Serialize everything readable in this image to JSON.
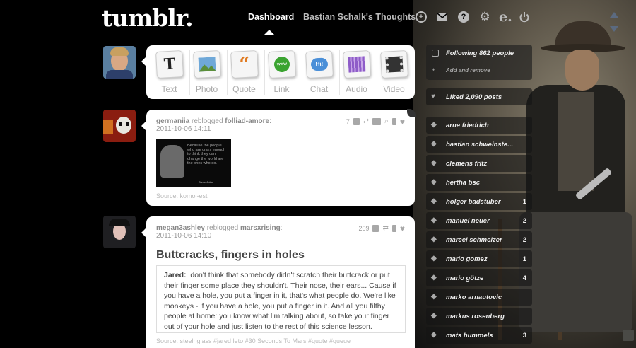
{
  "header": {
    "logo": "tumblr.",
    "nav_dashboard": "Dashboard",
    "nav_blog": "Bastian Schalk's Thoughts",
    "icons": [
      "plus-circle-icon",
      "mail-icon",
      "help-icon",
      "gear-icon",
      "etsy-e-icon",
      "power-icon"
    ]
  },
  "compose": {
    "items": [
      {
        "label": "Text",
        "icon": "T"
      },
      {
        "label": "Photo",
        "icon": "photo"
      },
      {
        "label": "Quote",
        "icon": "quote"
      },
      {
        "label": "Link",
        "icon": "www"
      },
      {
        "label": "Chat",
        "icon": "Hi!"
      },
      {
        "label": "Audio",
        "icon": "audio"
      },
      {
        "label": "Video",
        "icon": "video"
      }
    ]
  },
  "posts": [
    {
      "user": "germaniia",
      "verb": "reblogged",
      "source_user": "folliad-amore",
      "date": "2011-10-06 14:11",
      "notes": "7",
      "image_caption": "Because the people who are crazy enough to think they can change the world are the ones who do.",
      "image_author": "Steve Jobs",
      "source": "Source: komol-esti"
    },
    {
      "user": "megan3ashley",
      "verb": "reblogged",
      "source_user": "marsxrising",
      "date": "2011-10-06 14:10",
      "notes": "209",
      "title": "Buttcracks, fingers in holes",
      "quote_speaker": "Jared:",
      "quote_text": "don't think that somebody didn't scratch their buttcrack or put their finger some place they shouldn't. Their nose, their ears... Cause if you have a hole, you put a finger in it, that's what people do. We're like monkeys - if you have a hole, you put a finger in it. And all you filthy people at home: you know what I'm talking about, so take your finger out of your hole and just listen to the rest of this science lesson.",
      "source": "Source: steelnglass   #jared leto   #30 Seconds To Mars   #quote   #queue"
    }
  ],
  "sidebar": {
    "following": "Following 862 people",
    "add_remove": "Add and remove",
    "liked": "Liked 2,090 posts",
    "tags": [
      {
        "label": "arne friedrich",
        "count": ""
      },
      {
        "label": "bastian schweinste...",
        "count": ""
      },
      {
        "label": "clemens fritz",
        "count": ""
      },
      {
        "label": "hertha bsc",
        "count": ""
      },
      {
        "label": "holger badstuber",
        "count": "1"
      },
      {
        "label": "manuel neuer",
        "count": "2"
      },
      {
        "label": "marcel schmelzer",
        "count": "2"
      },
      {
        "label": "mario gomez",
        "count": "1"
      },
      {
        "label": "mario götze",
        "count": "4"
      },
      {
        "label": "marko arnautovic",
        "count": ""
      },
      {
        "label": "markus rosenberg",
        "count": ""
      },
      {
        "label": "mats hummels",
        "count": "3"
      }
    ]
  }
}
